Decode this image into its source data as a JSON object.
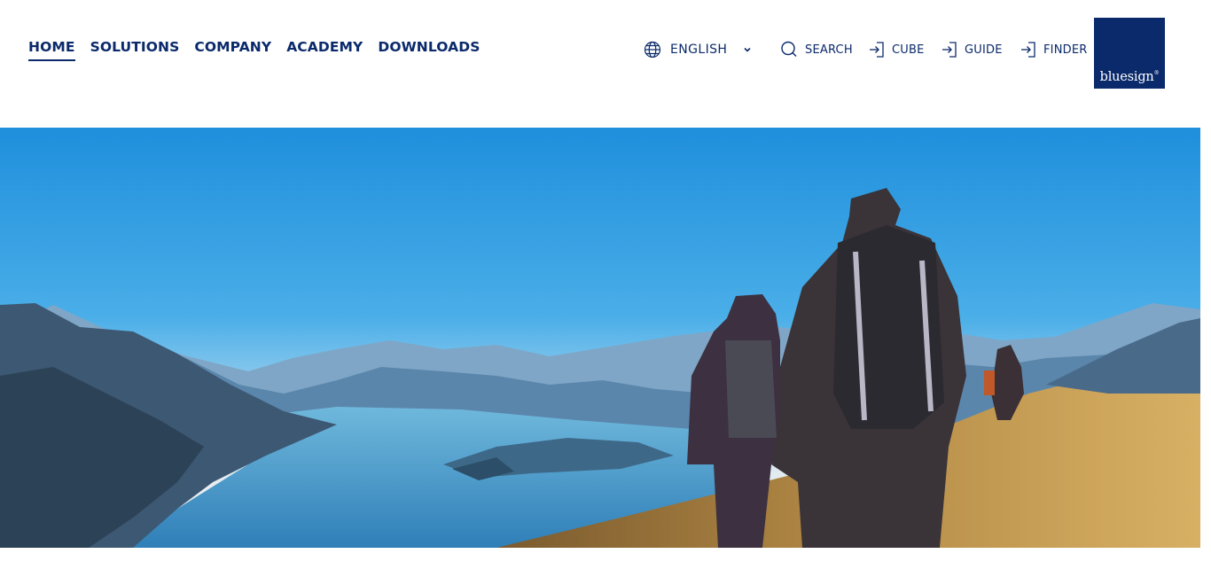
{
  "nav": {
    "items": [
      {
        "label": "HOME",
        "active": true
      },
      {
        "label": "SOLUTIONS",
        "active": false
      },
      {
        "label": "COMPANY",
        "active": false
      },
      {
        "label": "ACADEMY",
        "active": false
      },
      {
        "label": "DOWNLOADS",
        "active": false
      }
    ]
  },
  "utility": {
    "language": {
      "label": "ENGLISH",
      "icon": "globe-icon",
      "dropdown_icon": "chevron-down-icon"
    },
    "search": {
      "label": "SEARCH",
      "icon": "search-icon"
    },
    "cube": {
      "label": "CUBE",
      "icon": "login-icon"
    },
    "guide": {
      "label": "GUIDE",
      "icon": "login-icon"
    },
    "finder": {
      "label": "FINDER",
      "icon": "login-icon"
    }
  },
  "logo": {
    "text": "bluesign",
    "mark": "®"
  },
  "colors": {
    "brand": "#0b2a6b",
    "background": "#ffffff"
  }
}
